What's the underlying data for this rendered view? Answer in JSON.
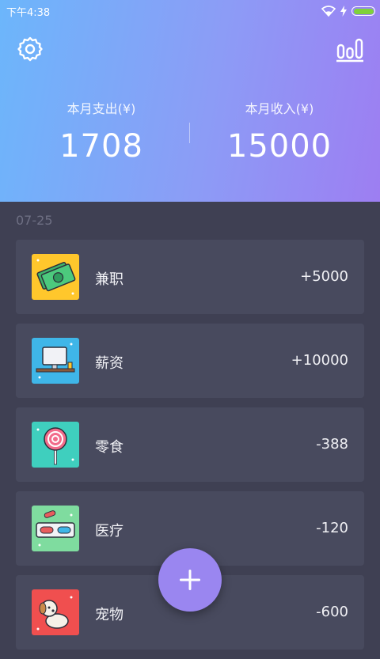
{
  "status_bar": {
    "time": "下午4:38"
  },
  "header": {
    "expense": {
      "label": "本月支出(¥)",
      "value": "1708"
    },
    "income": {
      "label": "本月收入(¥)",
      "value": "15000"
    }
  },
  "colors": {
    "gradient_start": "#6cb6fb",
    "gradient_end": "#9d7ef2",
    "background": "#3f4053",
    "card": "#484a5e",
    "fab": "#9a86f0"
  },
  "date_group": "07-25",
  "records": [
    {
      "name": "兼职",
      "amount": "+5000",
      "icon": "money-icon"
    },
    {
      "name": "薪资",
      "amount": "+10000",
      "icon": "salary-desk-icon"
    },
    {
      "name": "零食",
      "amount": "-388",
      "icon": "lollipop-icon"
    },
    {
      "name": "医疗",
      "amount": "-120",
      "icon": "pills-icon"
    },
    {
      "name": "宠物",
      "amount": "-600",
      "icon": "dog-icon"
    }
  ]
}
